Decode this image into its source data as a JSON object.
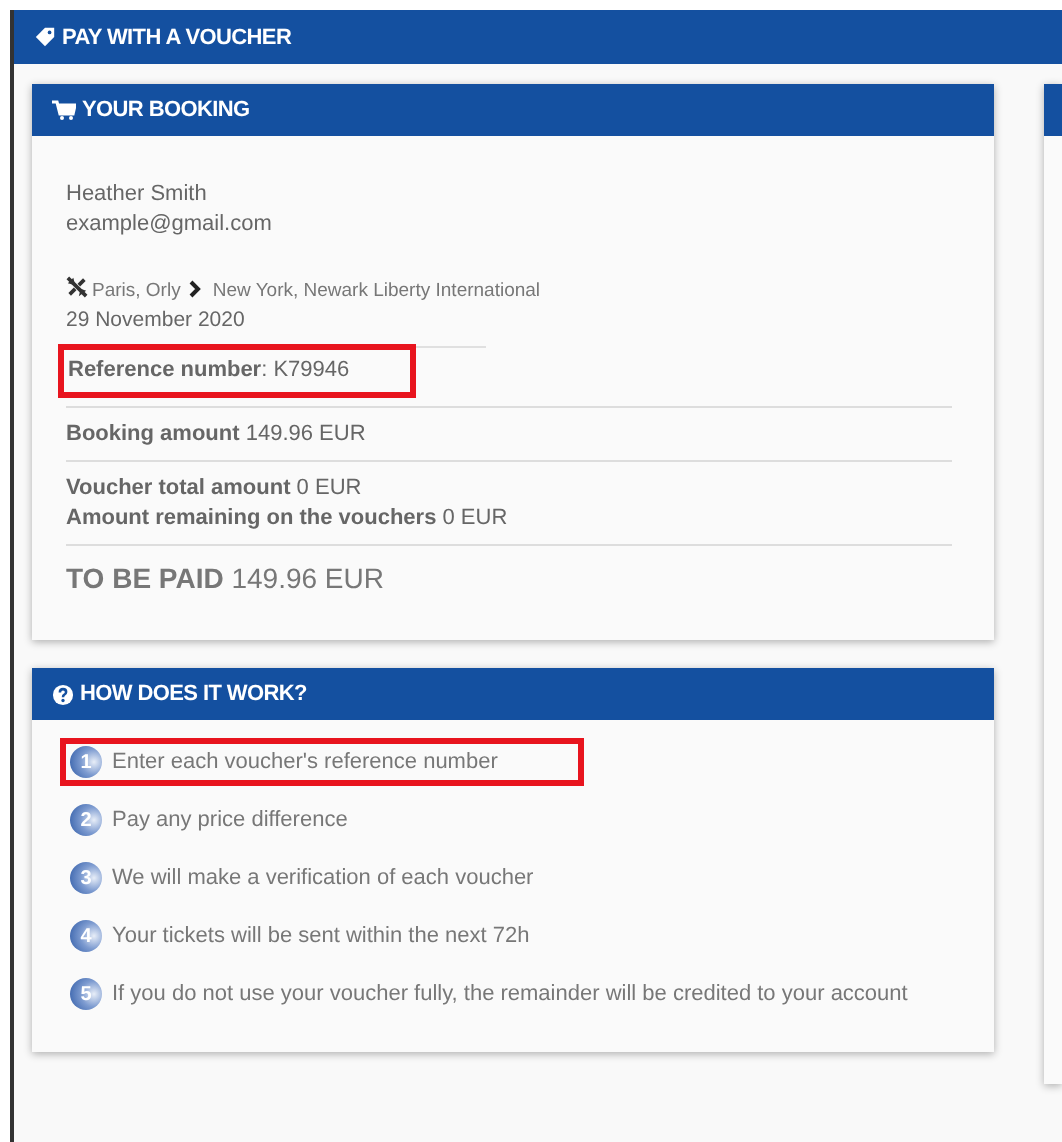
{
  "page_title": "PAY WITH A VOUCHER",
  "booking": {
    "title": "YOUR BOOKING",
    "customer_name": "Heather Smith",
    "email": "example@gmail.com",
    "origin": "Paris, Orly",
    "destination": "New York, Newark Liberty International",
    "date": "29 November 2020",
    "reference": {
      "text": "**Reference number**: K79946",
      "highlighted": true
    },
    "booking_amount": "**Booking amount** 149.96 EUR",
    "voucher_total": "**Voucher total amount** 0 EUR",
    "voucher_remaining": "**Amount remaining on the vouchers** 0 EUR",
    "to_be_paid": "**TO BE PAID** 149.96 EUR"
  },
  "how_it_works": {
    "title": "HOW DOES IT WORK?",
    "steps": [
      {
        "number": "1",
        "text": "Enter each voucher's reference number",
        "highlighted": true
      },
      {
        "number": "2",
        "text": "Pay any price difference",
        "highlighted": false
      },
      {
        "number": "3",
        "text": "We will make a verification of each voucher",
        "highlighted": false
      },
      {
        "number": "4",
        "text": "Your tickets will be sent within the next 72h",
        "highlighted": false
      },
      {
        "number": "5",
        "text": "If you do not use your voucher fully, the remainder will be credited to your account",
        "highlighted": false
      }
    ]
  }
}
